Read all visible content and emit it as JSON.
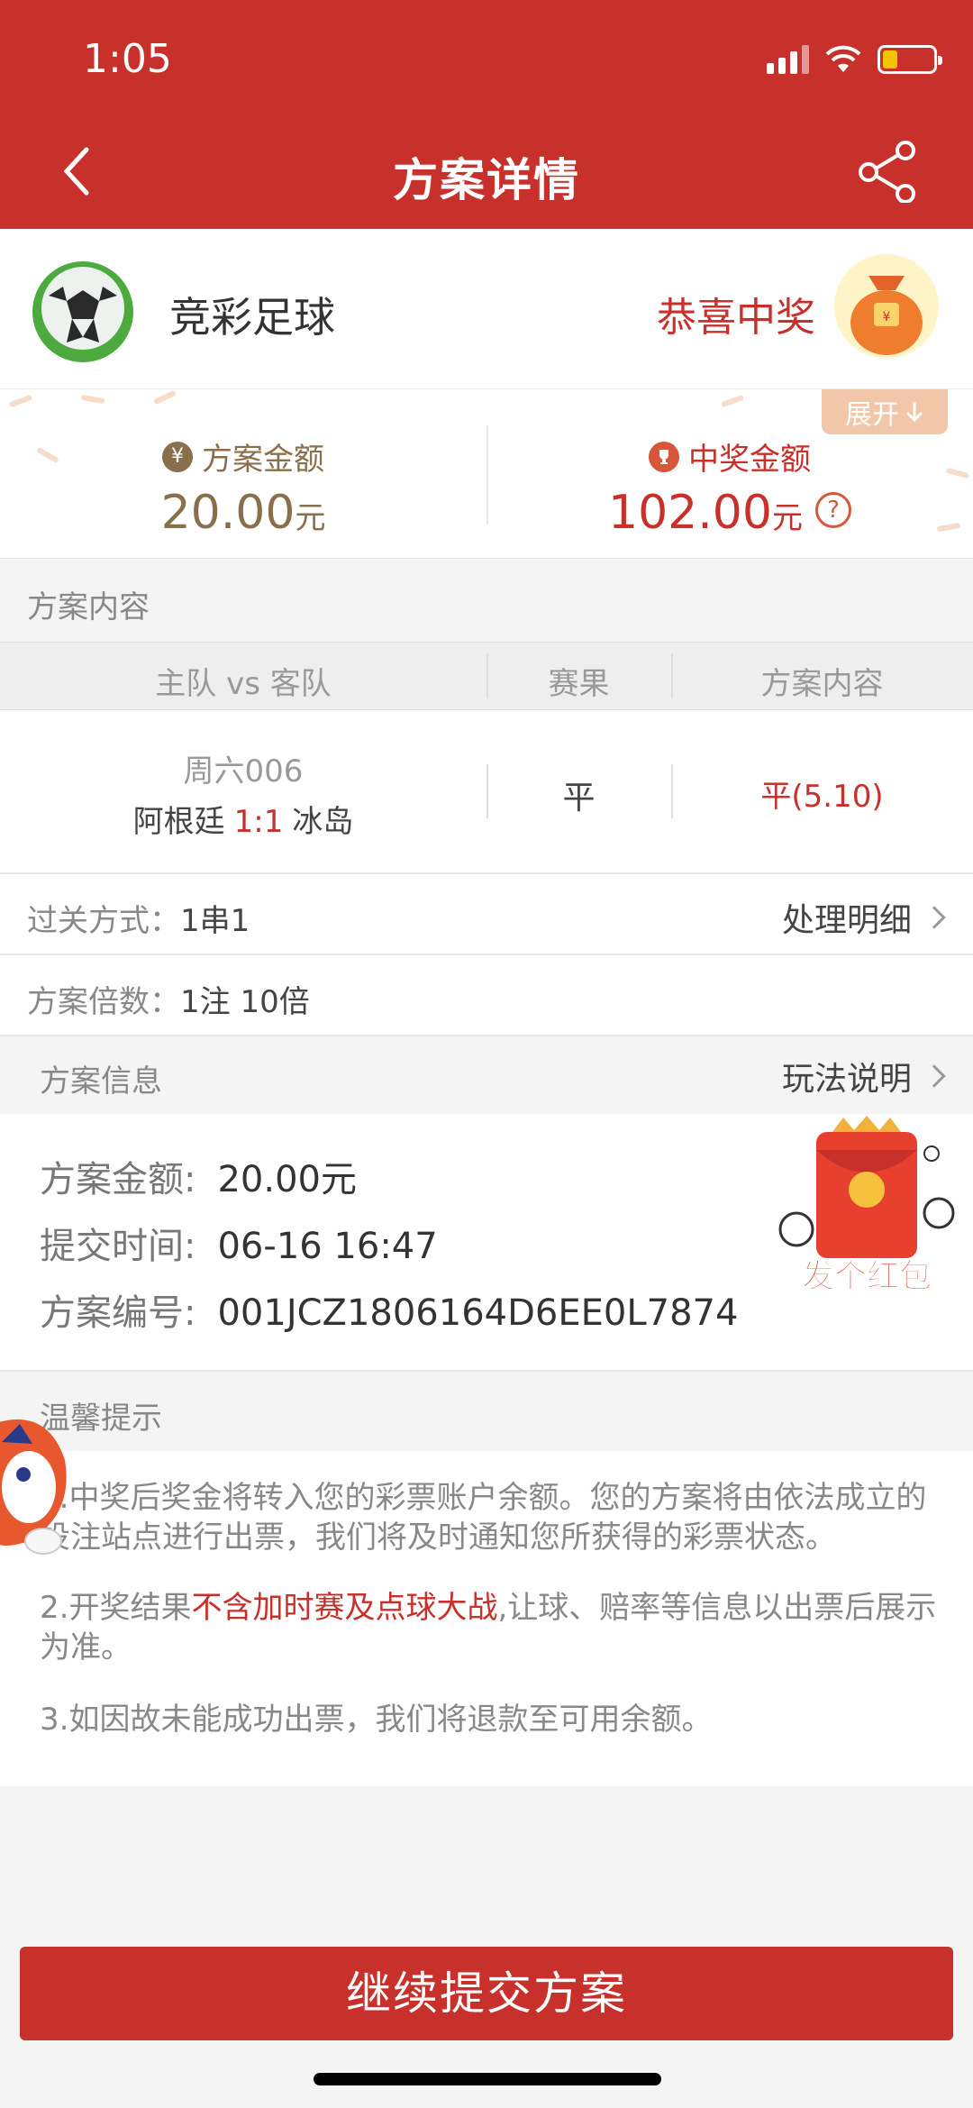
{
  "status": {
    "time": "1:05"
  },
  "nav": {
    "title": "方案详情",
    "back_icon": "back-arrow-icon",
    "share_icon": "share-icon"
  },
  "lottery": {
    "name": "竞彩足球",
    "win_text": "恭喜中奖"
  },
  "amounts": {
    "expand_label": "展开",
    "plan_label": "方案金额",
    "plan_value": "20.00",
    "plan_unit": "元",
    "plan_currency_symbol": "¥",
    "prize_label": "中奖金额",
    "prize_value": "102.00",
    "prize_unit": "元",
    "help_symbol": "?"
  },
  "content_section": {
    "title": "方案内容"
  },
  "table": {
    "headers": [
      "主队 vs 客队",
      "赛果",
      "方案内容"
    ],
    "rows": [
      {
        "match_no": "周六006",
        "home": "阿根廷",
        "score": "1:1",
        "away": "冰岛",
        "result": "平",
        "plan": "平(5.10)"
      }
    ]
  },
  "pass_mode": {
    "label": "过关方式：",
    "value": "1串1",
    "link": "处理明细"
  },
  "multiple": {
    "label": "方案倍数：",
    "value": "1注 10倍"
  },
  "info_section": {
    "title": "方案信息",
    "link": "玩法说明"
  },
  "plan_info": {
    "amount_label": "方案金额:",
    "amount_value": "20.00元",
    "time_label": "提交时间:",
    "time_value": "06-16 16:47",
    "id_label": "方案编号:",
    "id_value": "001JCZ1806164D6EE0L7874",
    "red_packet_text": "发个红包"
  },
  "tips": {
    "title": "温馨提示",
    "tip1": "1.中奖后奖金将转入您的彩票账户余额。您的方案将由依法成立的投注站点进行出票，我们将及时通知您所获得的彩票状态。",
    "tip2_a": "2.开奖结果",
    "tip2_hl": "不含加时赛及点球大战",
    "tip2_b": ",让球、赔率等信息以出票后展示为准。",
    "tip3": "3.如因故未能成功出票，我们将退款至可用余额。"
  },
  "submit_button": "继续提交方案",
  "colors": {
    "brand_red": "#c8302b",
    "gold": "#8a6f4d",
    "bg": "#f4f4f4"
  }
}
